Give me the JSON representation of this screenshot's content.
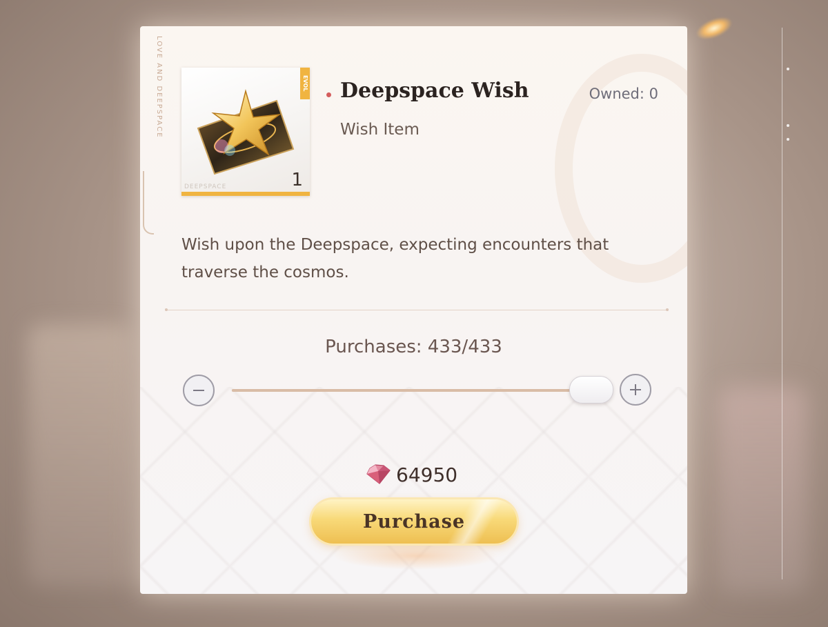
{
  "item": {
    "name": "Deepspace Wish",
    "type": "Wish Item",
    "owned": "Owned: 0",
    "card_count": "1",
    "card_brand": "DEEPSPACE",
    "card_tag": "EVOL",
    "description": "Wish upon the Deepspace, expecting encounters that traverse the cosmos."
  },
  "panel": {
    "side_text": "LOVE AND DEEPSPACE"
  },
  "quantity": {
    "purchases_label": "Purchases: 433/433",
    "current": 433,
    "max": 433,
    "slider_fraction": 1.0
  },
  "cost": {
    "currency_icon": "diamond-gem-icon",
    "value": "64950"
  },
  "actions": {
    "purchase_label": "Purchase"
  },
  "colors": {
    "accent_gold": "#f0b441",
    "title_dot": "#d45d5d",
    "gem": "#d9607a"
  }
}
